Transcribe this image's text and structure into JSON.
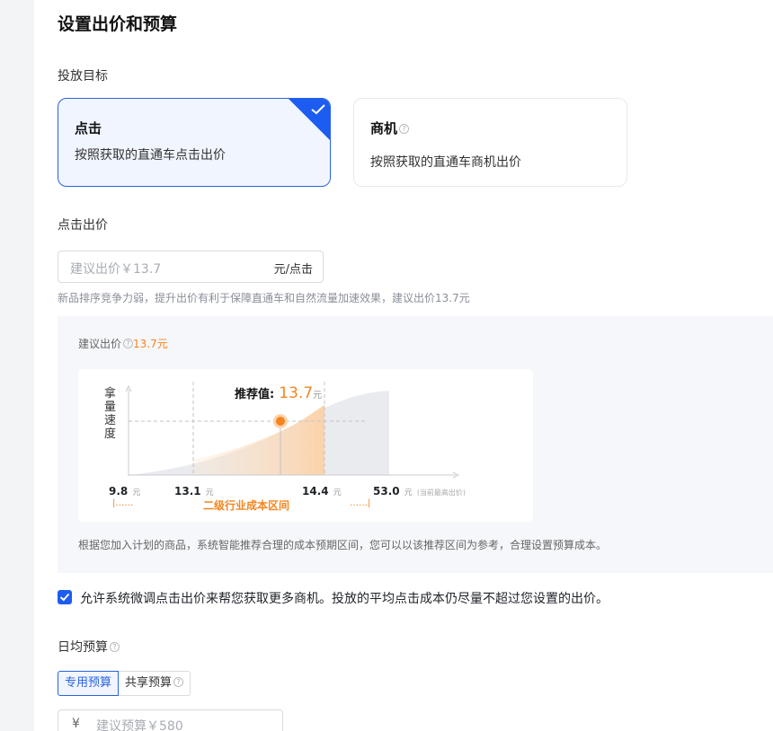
{
  "page": {
    "title": "设置出价和预算"
  },
  "goal": {
    "label": "投放目标",
    "options": [
      {
        "title": "点击",
        "desc": "按照获取的直通车点击出价",
        "selected": true
      },
      {
        "title": "商机",
        "desc": "按照获取的直通车商机出价",
        "selected": false
      }
    ]
  },
  "click_bid": {
    "label": "点击出价",
    "placeholder": "建议出价￥13.7",
    "unit": "元/点击",
    "hint": "新品排序竞争力弱，提升出价有利于保障直通车和自然流量加速效果，建议出价13.7元"
  },
  "suggest": {
    "prefix": "建议出价",
    "value": "13.7元",
    "note": "根据您加入计划的商品，系统智能推荐合理的成本预期区间，您可以以该推荐区间为参考，合理设置预算成本。"
  },
  "chart_data": {
    "type": "area",
    "ylabel": "拿量速度",
    "recommend_label": "推荐值:",
    "recommend_value": "13.7",
    "recommend_unit": "元",
    "ticks": [
      {
        "value": "9.8",
        "unit": "元",
        "extra": ""
      },
      {
        "value": "13.1",
        "unit": "元",
        "extra": ""
      },
      {
        "value": "14.4",
        "unit": "元",
        "extra": ""
      },
      {
        "value": "53.0",
        "unit": "元",
        "extra": "(当前最高出价)"
      }
    ],
    "range_label": "二级行业成本区间",
    "range_left": "|……",
    "range_right": "……|",
    "recommended_x": 13.7,
    "range": [
      13.1,
      14.4
    ],
    "xlim": [
      9.8,
      53.0
    ],
    "grid": false
  },
  "adjust": {
    "checked": true,
    "text": "允许系统微调点击出价来帮您获取更多商机。投放的平均点击成本仍尽量不超过您设置的出价。"
  },
  "budget": {
    "label": "日均预算",
    "tabs": [
      {
        "label": "专用预算",
        "active": true
      },
      {
        "label": "共享预算",
        "active": false
      }
    ],
    "currency": "¥",
    "placeholder": "建议预算￥580"
  },
  "colors": {
    "accent": "#1d5cf0",
    "orange": "#f5841f"
  }
}
